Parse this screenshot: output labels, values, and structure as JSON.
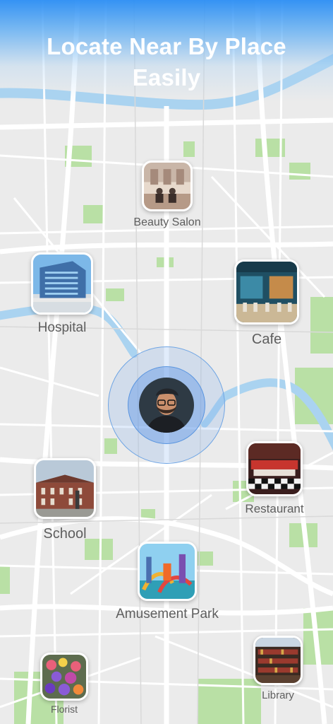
{
  "headline": {
    "line1": "Locate Near By Place",
    "line2": "Easily"
  },
  "colors": {
    "accent": "#2b8ef4",
    "map_bg": "#ebebeb",
    "road": "#ffffff",
    "water": "#aad3f0",
    "park": "#b9e0a5",
    "label": "#5e5e5e"
  },
  "user": {
    "avatar_icon": "user-avatar-icon"
  },
  "places": {
    "beauty_salon": {
      "label": "Beauty Salon"
    },
    "hospital": {
      "label": "Hospital"
    },
    "cafe": {
      "label": "Cafe"
    },
    "restaurant": {
      "label": "Restaurant"
    },
    "school": {
      "label": "School"
    },
    "amusement_park": {
      "label": "Amusement Park"
    },
    "florist": {
      "label": "Florist"
    },
    "library": {
      "label": "Library"
    }
  }
}
